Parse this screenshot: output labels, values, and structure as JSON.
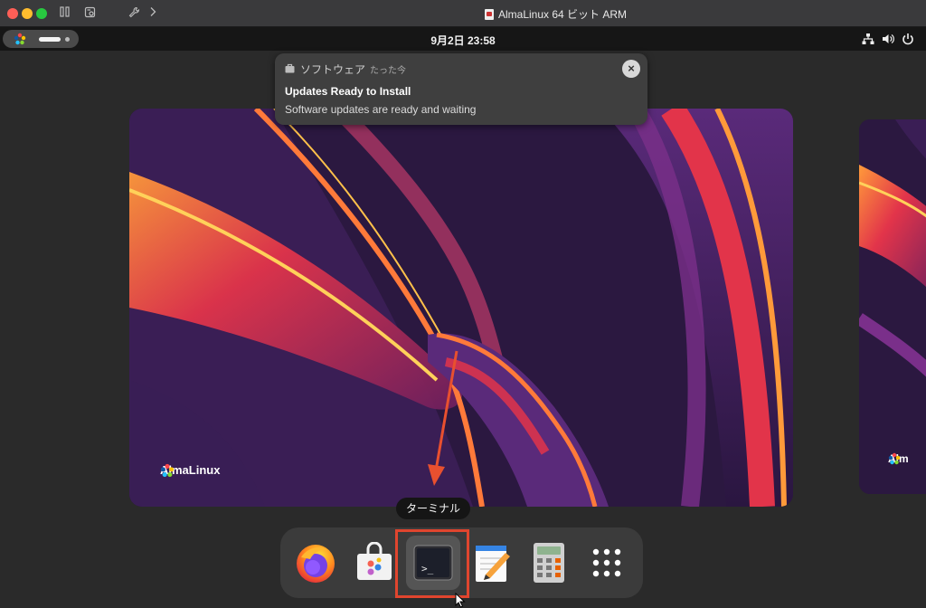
{
  "window": {
    "title": "AlmaLinux 64 ビット ARM"
  },
  "topbar": {
    "clock": "9月2日  23:58",
    "tray_icons": [
      "network-icon",
      "volume-icon",
      "power-icon"
    ]
  },
  "notification": {
    "app_name": "ソフトウェア",
    "time": "たった今",
    "title": "Updates Ready to Install",
    "body": "Software updates are ready and waiting",
    "close_label": "×"
  },
  "workspace": {
    "brand": "AlmaLinux",
    "brand_side": "Alm"
  },
  "dash": {
    "tooltip": "ターミナル",
    "items": [
      {
        "name": "firefox",
        "icon": "firefox-icon"
      },
      {
        "name": "software",
        "icon": "software-store-icon"
      },
      {
        "name": "terminal",
        "icon": "terminal-icon",
        "active": true
      },
      {
        "name": "text-editor",
        "icon": "text-editor-icon"
      },
      {
        "name": "calculator",
        "icon": "calculator-icon"
      },
      {
        "name": "show-apps",
        "icon": "app-grid-icon"
      }
    ],
    "terminal_prompt": ">_"
  },
  "colors": {
    "accent_highlight": "#e0452e",
    "wallpaper_base": "#2b1840"
  }
}
